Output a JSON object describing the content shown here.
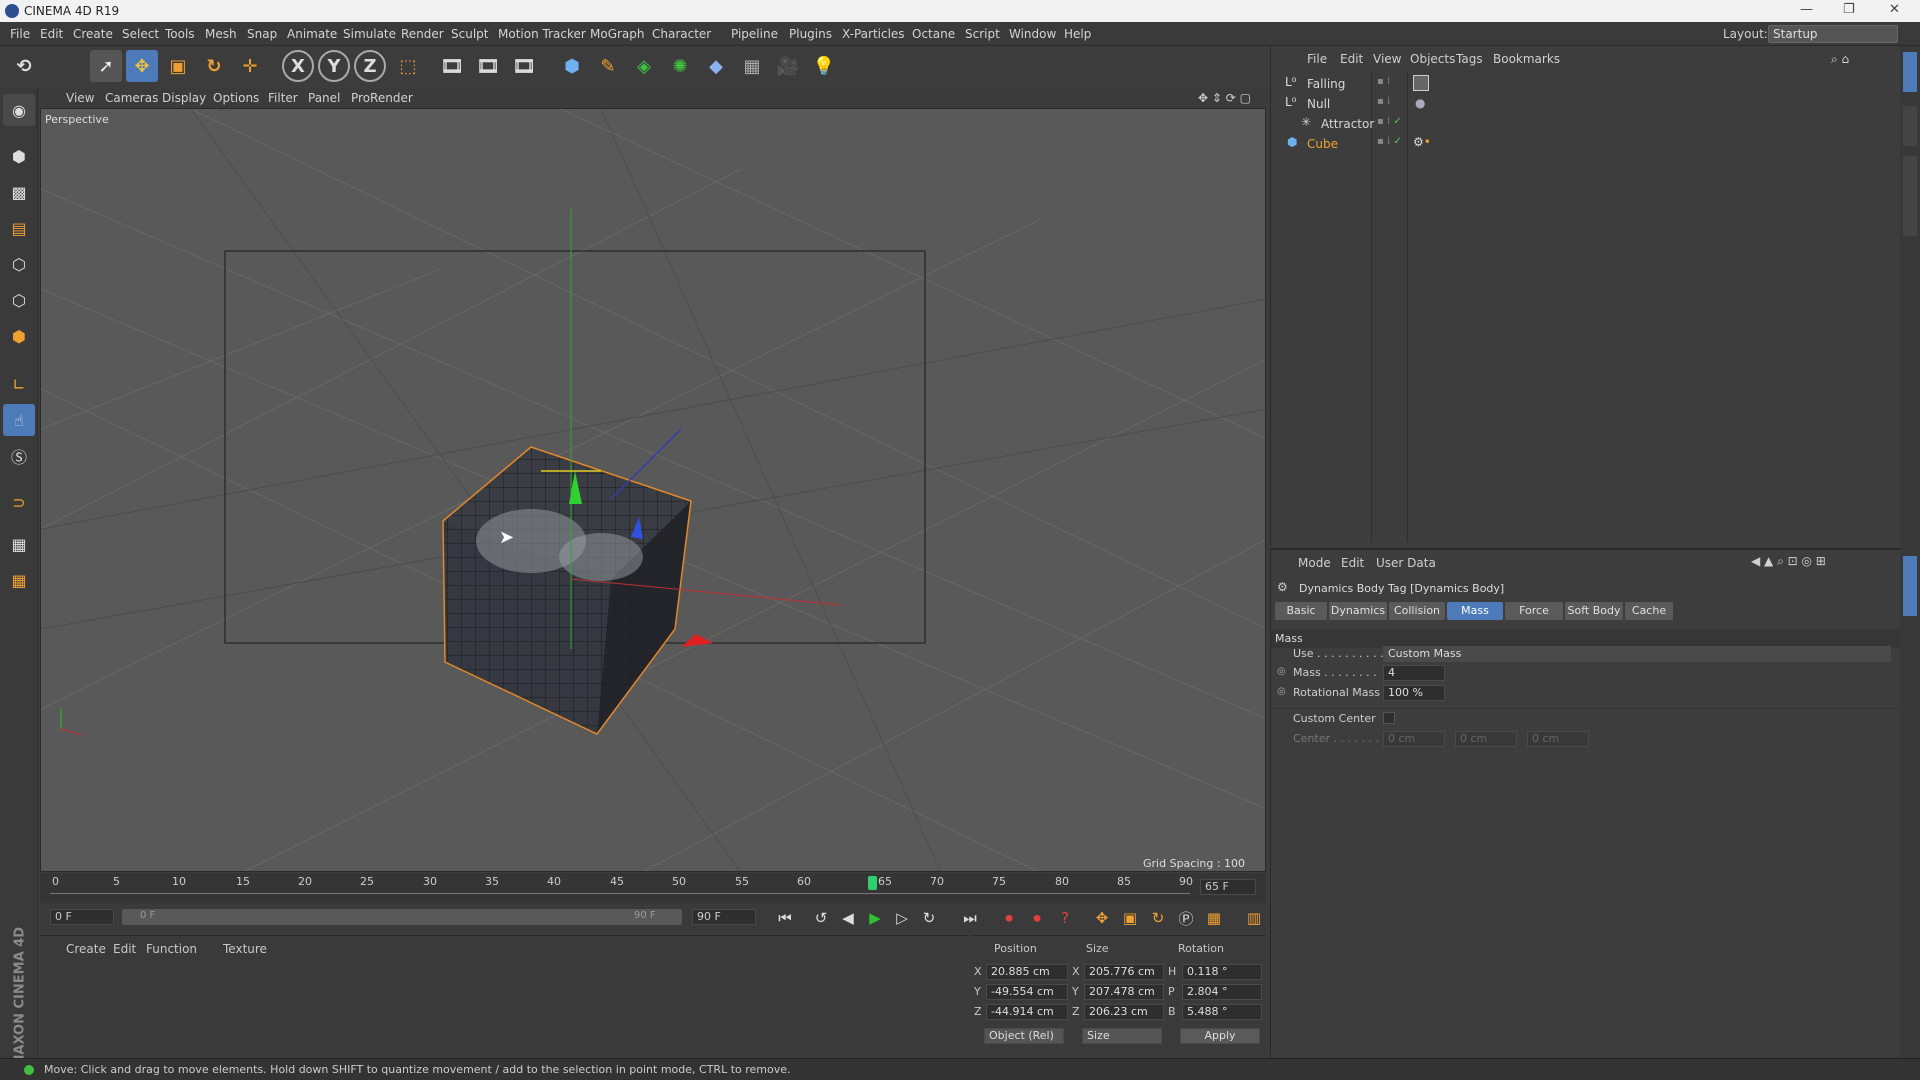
{
  "window": {
    "title": "CINEMA 4D R19"
  },
  "menu": [
    "File",
    "Edit",
    "Create",
    "Select",
    "Tools",
    "Mesh",
    "Snap",
    "Animate",
    "Simulate",
    "Render",
    "Sculpt",
    "Motion Tracker",
    "MoGraph",
    "Character",
    "Pipeline",
    "Plugins",
    "X-Particles",
    "Octane",
    "Script",
    "Window",
    "Help"
  ],
  "layout": {
    "label": "Layout:",
    "value": "Startup"
  },
  "viewport": {
    "menu": [
      "View",
      "Cameras",
      "Display",
      "Options",
      "Filter",
      "Panel",
      "ProRender"
    ],
    "label": "Perspective",
    "grid_spacing": "Grid Spacing : 100 cm"
  },
  "timeline": {
    "ticks": [
      "0",
      "5",
      "10",
      "15",
      "20",
      "25",
      "30",
      "35",
      "40",
      "45",
      "50",
      "55",
      "60",
      "65",
      "70",
      "75",
      "80",
      "85",
      "90"
    ],
    "current": "65 F",
    "current_frame": 65,
    "start": "0 F",
    "range_start": "0 F",
    "range_end": "90 F",
    "end": "90 F"
  },
  "material_menu": [
    "Create",
    "Edit",
    "Function",
    "Texture"
  ],
  "coords": {
    "headers": [
      "Position",
      "Size",
      "Rotation"
    ],
    "rows": [
      {
        "axis": "X",
        "pos": "20.885 cm",
        "size_axis": "X",
        "size": "205.776 cm",
        "rot_axis": "H",
        "rot": "0.118 °"
      },
      {
        "axis": "Y",
        "pos": "-49.554 cm",
        "size_axis": "Y",
        "size": "207.478 cm",
        "rot_axis": "P",
        "rot": "2.804 °"
      },
      {
        "axis": "Z",
        "pos": "-44.914 cm",
        "size_axis": "Z",
        "size": "206.23 cm",
        "rot_axis": "B",
        "rot": "5.488 °"
      }
    ],
    "mode": "Object (Rel)",
    "size_mode": "Size",
    "apply": "Apply"
  },
  "object_manager": {
    "menu": [
      "File",
      "Edit",
      "View",
      "Objects",
      "Tags",
      "Bookmarks"
    ],
    "objects": [
      {
        "name": "Falling",
        "level": 0
      },
      {
        "name": "Null",
        "level": 0
      },
      {
        "name": "Attractor",
        "level": 1
      },
      {
        "name": "Cube",
        "level": 0
      }
    ]
  },
  "attributes": {
    "menu": [
      "Mode",
      "Edit",
      "User Data"
    ],
    "header": "Dynamics Body Tag [Dynamics Body]",
    "tabs": [
      "Basic",
      "Dynamics",
      "Collision",
      "Mass",
      "Force",
      "Soft Body",
      "Cache"
    ],
    "active_tab": "Mass",
    "section": "Mass",
    "use_label": "Use . . . . . . . . . .",
    "use_value": "Custom Mass",
    "mass_label": "Mass . . . . . . . .",
    "mass_value": "4",
    "rot_mass_label": "Rotational Mass",
    "rot_mass_value": "100 %",
    "custom_center_label": "Custom Center",
    "center_label": "Center . . . . . . .",
    "center_values": [
      "0 cm",
      "0 cm",
      "0 cm"
    ]
  },
  "status": "Move: Click and drag to move elements. Hold down SHIFT to quantize movement / add to the selection in point mode, CTRL to remove.",
  "brand": "MAXON CINEMA 4D",
  "colors": {
    "accent": "#4d7ab8",
    "selection": "#f0a030",
    "x_axis": "#e03030",
    "y_axis": "#30c030",
    "z_axis": "#3050e0"
  }
}
